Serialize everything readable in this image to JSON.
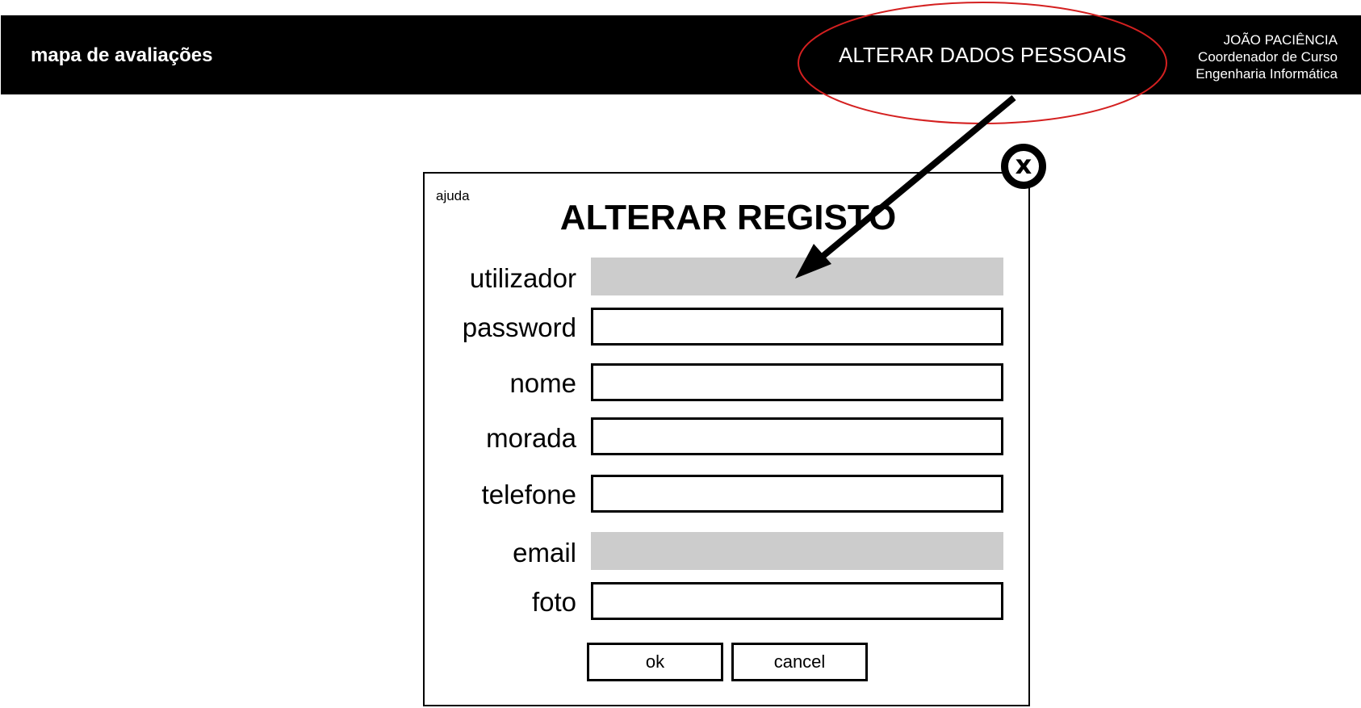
{
  "header": {
    "app_title": "mapa de avaliações",
    "alter_personal_data_link": "ALTERAR DADOS PESSOAIS",
    "user": {
      "name": "JOÃO PACIÊNCIA",
      "role": "Coordenador de Curso",
      "department": "Engenharia Informática"
    }
  },
  "dialog": {
    "help_link": "ajuda",
    "title": "ALTERAR REGISTO",
    "close_icon": "x-icon",
    "fields": [
      {
        "label": "utilizador",
        "value": "",
        "disabled": true
      },
      {
        "label": "password",
        "value": "",
        "disabled": false
      },
      {
        "label": "nome",
        "value": "",
        "disabled": false
      },
      {
        "label": "morada",
        "value": "",
        "disabled": false
      },
      {
        "label": "telefone",
        "value": "",
        "disabled": false
      },
      {
        "label": "email",
        "value": "",
        "disabled": true
      },
      {
        "label": "foto",
        "value": "",
        "disabled": false
      }
    ],
    "ok_label": "ok",
    "cancel_label": "cancel"
  },
  "colors": {
    "header_bg": "#000000",
    "header_text": "#ffffff",
    "annotation_ellipse": "#d42020",
    "disabled_field_bg": "#cccccc"
  }
}
